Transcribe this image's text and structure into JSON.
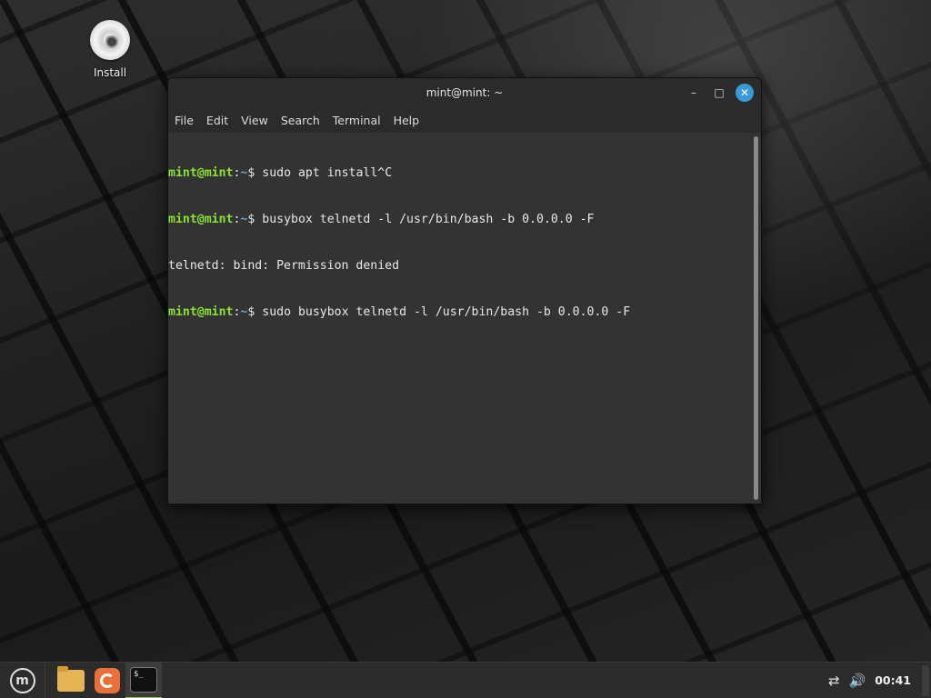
{
  "desktop": {
    "icons": [
      {
        "label": "Install",
        "icon": "disc-icon"
      }
    ]
  },
  "terminal": {
    "title": "mint@mint: ~",
    "controls": {
      "minimize": "–",
      "maximize": "□",
      "close": "✕"
    },
    "menu": [
      "File",
      "Edit",
      "View",
      "Search",
      "Terminal",
      "Help"
    ],
    "lines": [
      {
        "user": "mint@mint",
        "path": "~",
        "cmd": "sudo apt install^C"
      },
      {
        "user": "mint@mint",
        "path": "~",
        "cmd": "busybox telnetd -l /usr/bin/bash -b 0.0.0.0 -F"
      },
      {
        "output": "telnetd: bind: Permission denied"
      },
      {
        "user": "mint@mint",
        "path": "~",
        "cmd": "sudo busybox telnetd -l /usr/bin/bash -b 0.0.0.0 -F"
      }
    ],
    "colors": {
      "user": "#8ae234",
      "path": "#6ea0d6",
      "text": "#e8e8e8",
      "background": "#333333"
    }
  },
  "panel": {
    "menu_icon": "linux-mint-logo-icon",
    "mint_logo_text": "m",
    "terminal_icon_text": "$_",
    "launchers": [
      "files-icon",
      "firefox-icon",
      "terminal-icon"
    ],
    "tray": {
      "network": "⇄",
      "volume": "🔊",
      "clock": "00:41"
    },
    "accent": "#8ac151"
  }
}
